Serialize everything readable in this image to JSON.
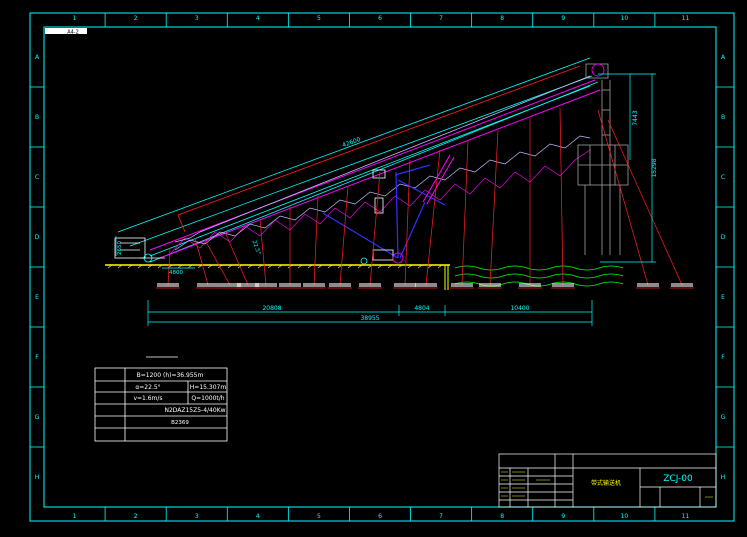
{
  "frame": {
    "columns": [
      "1",
      "2",
      "3",
      "4",
      "5",
      "6",
      "7",
      "8",
      "9",
      "10",
      "11"
    ],
    "rows": [
      "A",
      "B",
      "C",
      "D",
      "E",
      "F",
      "G",
      "H"
    ],
    "corner_tag": "A4-2"
  },
  "dimensions": {
    "incline_length": "42600",
    "total_span": "38955",
    "left_span": "20808",
    "mid_span": "4804",
    "right_span": "10400",
    "tail_offset": "4800",
    "tail_height": "2650",
    "col_height": "22.5°",
    "head_height_upper": "7443",
    "head_height_total": "15298"
  },
  "spec_table": {
    "rows": [
      [
        "B=1200 (h)=36.955m"
      ],
      [
        "α=22.5°",
        "H=15.307m"
      ],
      [
        "v=1.6m/s",
        "Q=1000t/h"
      ],
      [
        "N2DAZ15Z5-4/40Kw"
      ],
      [
        "B2369"
      ]
    ]
  },
  "title_block": {
    "drawing_name": "带式输送机",
    "drawing_no": "ZCJ-00"
  },
  "colors": {
    "frame": "#00ffff",
    "structure": "#ff00ff",
    "belt": "#00ffff",
    "callout": "#ff2020",
    "support": "#3030ff",
    "ground": "#ffff00",
    "water": "#00ff00",
    "label": "#ffffff"
  }
}
